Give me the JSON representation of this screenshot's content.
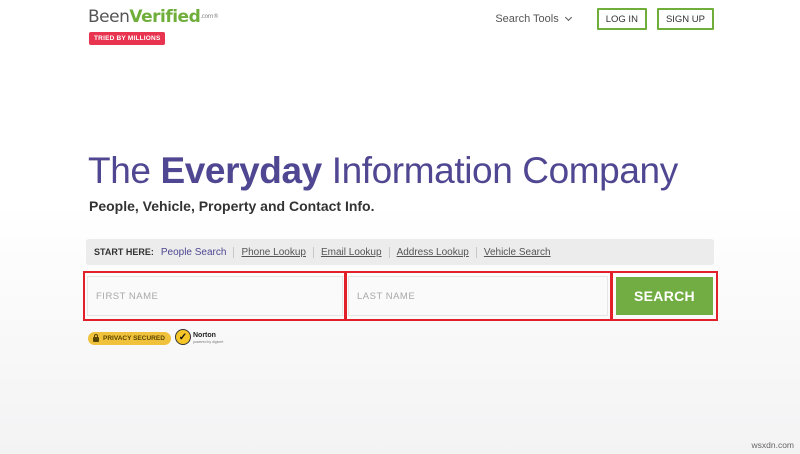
{
  "logo": {
    "been": "Been",
    "verified": "Verified",
    "com": ".com",
    "reg": "®",
    "badge": "TRIED BY MILLIONS"
  },
  "nav": {
    "search_tools": "Search Tools",
    "login": "LOG IN",
    "signup": "SIGN UP"
  },
  "hero": {
    "headline_pre": "The ",
    "headline_bold": "Everyday",
    "headline_post": " Information Company",
    "subhead": "People, Vehicle, Property and Contact Info."
  },
  "tabs": {
    "start_here": "START HERE:",
    "items": [
      {
        "label": "People Search"
      },
      {
        "label": "Phone Lookup"
      },
      {
        "label": "Email Lookup"
      },
      {
        "label": "Address Lookup"
      },
      {
        "label": "Vehicle Search"
      }
    ],
    "active_index": 0
  },
  "form": {
    "first_name_placeholder": "FIRST NAME",
    "last_name_placeholder": "LAST NAME",
    "search_label": "SEARCH"
  },
  "badges": {
    "privacy": "PRIVACY SECURED",
    "norton": "Norton",
    "norton_sub": "powered by digicert"
  },
  "watermark": "wsxdn.com",
  "colors": {
    "brand_purple": "#4f4791",
    "brand_green": "#6fae3a",
    "badge_red": "#e8344e",
    "highlight_red": "#e2202a"
  }
}
